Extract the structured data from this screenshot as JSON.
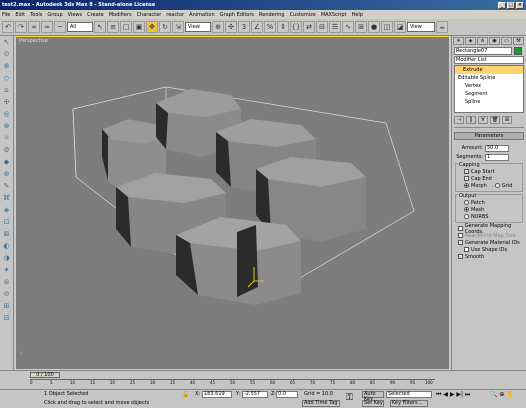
{
  "app": {
    "title": "test2.max - Autodesk 3ds Max 8 - Stand-alone License"
  },
  "menu": [
    "File",
    "Edit",
    "Tools",
    "Group",
    "Views",
    "Create",
    "Modifiers",
    "Character",
    "reactor",
    "Animation",
    "Graph Editors",
    "Rendering",
    "Customize",
    "MAXScript",
    "Help"
  ],
  "toolbar": {
    "selection_filter": "All",
    "ref_coord": "View",
    "view_dropdown": "View"
  },
  "viewport": {
    "label": "Perspective"
  },
  "command_panel": {
    "object_name": "Rectangle07",
    "object_color": "#1e9a2e",
    "modifier_list": "Modifier List",
    "stack": [
      "Extrude",
      "Editable Spline",
      "Vertex",
      "Segment",
      "Spline"
    ],
    "params_title": "Parameters",
    "amount_label": "Amount:",
    "amount": "50.0",
    "segments_label": "Segments:",
    "segments": "1",
    "capping_title": "Capping",
    "cap_start": "Cap Start",
    "cap_end": "Cap End",
    "morph": "Morph",
    "grid": "Grid",
    "output_title": "Output",
    "patch": "Patch",
    "mesh": "Mesh",
    "nurbs": "NURBS",
    "gen_mapping": "Generate Mapping Coords.",
    "realworld": "Real-World Map Size",
    "gen_matids": "Generate Material IDs",
    "use_shape_ids": "Use Shape IDs",
    "smooth": "Smooth"
  },
  "timeline": {
    "frame": "0 / 100",
    "ticks": [
      "0",
      "5",
      "10",
      "15",
      "20",
      "25",
      "30",
      "35",
      "40",
      "45",
      "50",
      "55",
      "60",
      "65",
      "70",
      "75",
      "80",
      "85",
      "90",
      "95",
      "100"
    ]
  },
  "status": {
    "selected": "1 Object Selected",
    "prompt": "Click and drag to select and move objects",
    "x": "183.619",
    "y": "-2.557",
    "z": "0.0",
    "grid": "Grid = 10.0",
    "add_time_tag": "Add Time Tag",
    "auto_key": "Auto Key",
    "set_key": "Set Key",
    "key_sel": "Selected",
    "key_filters": "Key Filters..."
  }
}
